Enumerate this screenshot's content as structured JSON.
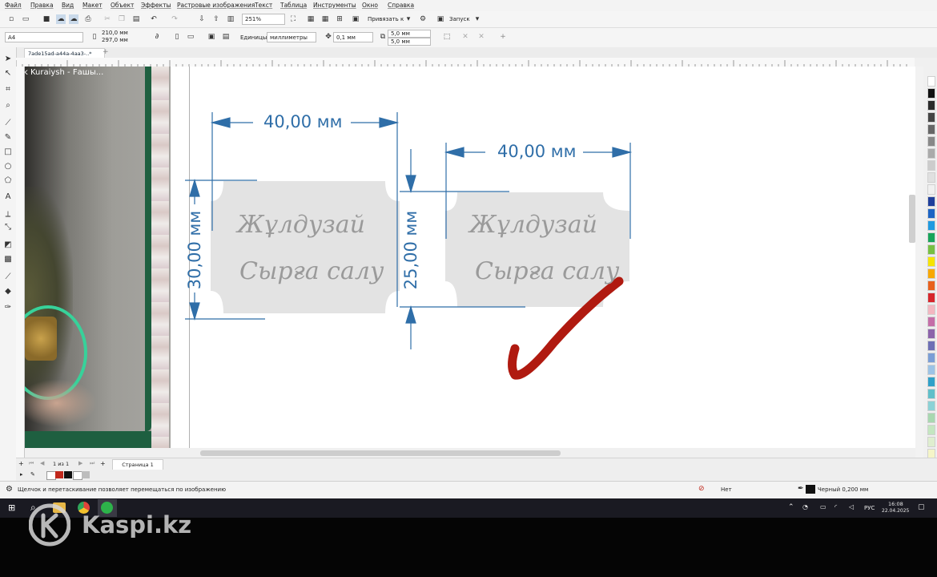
{
  "menu": [
    "Файл",
    "Правка",
    "Вид",
    "Макет",
    "Объект",
    "Эффекты",
    "Растровые изображения",
    "Текст",
    "Таблица",
    "Инструменты",
    "Окно",
    "Справка"
  ],
  "toolbar": {
    "zoom": "251%",
    "snap_label": "Привязать к",
    "launch_label": "Запуск"
  },
  "property_bar": {
    "page_size": "A4",
    "width": "210,0 мм",
    "height": "297,0 мм",
    "units_label": "Единицы:",
    "units_value": "миллиметры",
    "nudge": "0,1 мм",
    "dup_x": "5,0 мм",
    "dup_y": "5,0 мм"
  },
  "document_tab": "7ade15ad-a44a-4aa3-..*",
  "photo_caption": "k Kuraiysh - Fашы...",
  "canvas": {
    "dim_top_left": "40,00 мм",
    "dim_top_right": "40,00 мм",
    "dim_side_left": "30,00 мм",
    "dim_side_right": "25,00 мм",
    "tag_line1": "Жұлдузай",
    "tag_line2": "Сырға салу",
    "accent_color": "#2f6ea8",
    "tag_color": "#e3e3e3",
    "check_color": "#b01a10"
  },
  "pager": {
    "count": "1 из 1",
    "page_tab": "Страница 1"
  },
  "status": {
    "hint": "Щелчок и перетаскивание позволяет перемещаться по изображению",
    "fill_label": "Нет",
    "outline_label": "Черный 0,200 мм"
  },
  "taskbar": {
    "lang": "РУС",
    "time": "16:08",
    "date": "22.04.2025"
  },
  "watermark": "Kaspi.kz"
}
